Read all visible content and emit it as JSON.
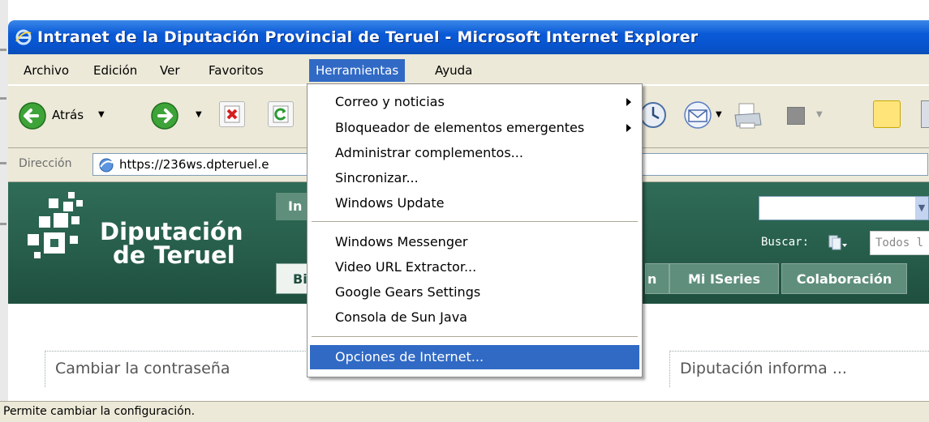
{
  "window": {
    "title": "Intranet de la Diputación Provincial de Teruel - Microsoft Internet Explorer"
  },
  "menubar": {
    "items": [
      "Archivo",
      "Edición",
      "Ver",
      "Favoritos",
      "Herramientas",
      "Ayuda"
    ],
    "active": "Herramientas"
  },
  "toolbar": {
    "back_label": "Atrás"
  },
  "address": {
    "label": "Dirección",
    "url": "https://236ws.dpteruel.e"
  },
  "page": {
    "logo_line1": "Diputación",
    "logo_line2": "de Teruel",
    "tab_top_partial": "In",
    "tab_bi_partial": "Bi",
    "tabs": [
      "Mi ISeries",
      "Colaboración"
    ],
    "search_label": "Buscar:",
    "search_scope": "Todos l",
    "section_left": "Cambiar la contraseña",
    "section_right": "Diputación informa ..."
  },
  "tools_menu": {
    "items": [
      {
        "label": "Correo y noticias",
        "submenu": true
      },
      {
        "label": "Bloqueador de elementos emergentes",
        "submenu": true
      },
      {
        "label": "Administrar complementos...",
        "submenu": false
      },
      {
        "label": "Sincronizar...",
        "submenu": false
      },
      {
        "label": "Windows Update",
        "submenu": false
      },
      {
        "label": "Windows Messenger",
        "submenu": false
      },
      {
        "label": "Video URL Extractor...",
        "submenu": false
      },
      {
        "label": "Google Gears Settings",
        "submenu": false
      },
      {
        "label": "Consola de Sun Java",
        "submenu": false
      },
      {
        "label": "Opciones de Internet...",
        "submenu": false
      }
    ],
    "highlighted": "Opciones de Internet..."
  },
  "status": {
    "text": "Permite cambiar la configuración."
  },
  "colors": {
    "xp_title_blue": "#0a5ad8",
    "menu_highlight": "#316ac5",
    "chrome": "#ece9d8",
    "banner_green": "#275e4b"
  }
}
